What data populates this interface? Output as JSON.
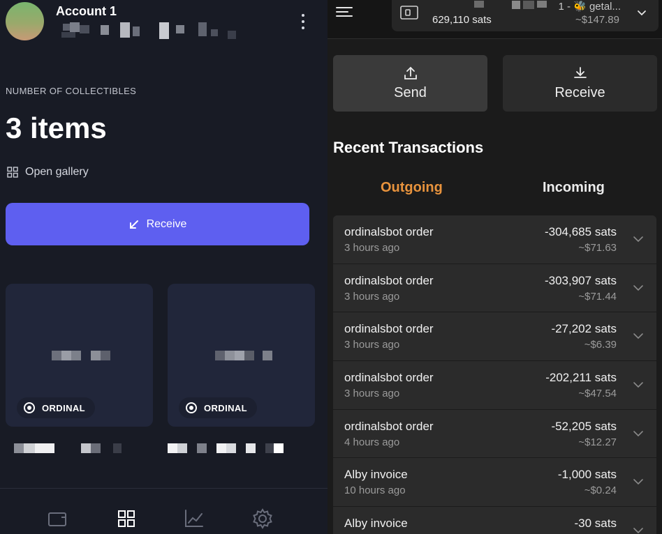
{
  "colors": {
    "left_bg": "#181b25",
    "accent": "#5e5ff0",
    "outgoing_tab": "#e8933d",
    "right_bg": "#1b1b1b",
    "card_bg": "#21263a"
  },
  "left": {
    "account_name": "Account 1",
    "collectibles_label": "NUMBER OF COLLECTIBLES",
    "collectibles_count": "3 items",
    "open_gallery_label": "Open gallery",
    "receive_label": "Receive",
    "cards": [
      {
        "badge_label": "ORDINAL"
      },
      {
        "badge_label": "ORDINAL"
      }
    ],
    "nav": [
      {
        "icon": "wallet-icon"
      },
      {
        "icon": "grid-icon"
      },
      {
        "icon": "chart-icon"
      },
      {
        "icon": "settings-icon"
      }
    ]
  },
  "right": {
    "account_selector": {
      "name_visible": "1 - 🐝 getal...",
      "balance_sats": "629,110 sats",
      "balance_usd": "~$147.89"
    },
    "actions": {
      "send_label": "Send",
      "receive_label": "Receive"
    },
    "recent_title": "Recent Transactions",
    "tabs": {
      "outgoing": "Outgoing",
      "incoming": "Incoming"
    },
    "transactions": [
      {
        "name": "ordinalsbot order",
        "time": "3 hours ago",
        "amount": "-304,685 sats",
        "usd": "~$71.63"
      },
      {
        "name": "ordinalsbot order",
        "time": "3 hours ago",
        "amount": "-303,907 sats",
        "usd": "~$71.44"
      },
      {
        "name": "ordinalsbot order",
        "time": "3 hours ago",
        "amount": "-27,202 sats",
        "usd": "~$6.39"
      },
      {
        "name": "ordinalsbot order",
        "time": "3 hours ago",
        "amount": "-202,211 sats",
        "usd": "~$47.54"
      },
      {
        "name": "ordinalsbot order",
        "time": "4 hours ago",
        "amount": "-52,205 sats",
        "usd": "~$12.27"
      },
      {
        "name": "Alby invoice",
        "time": "10 hours ago",
        "amount": "-1,000 sats",
        "usd": "~$0.24"
      },
      {
        "name": "Alby invoice",
        "time": "",
        "amount": "-30 sats",
        "usd": ""
      }
    ]
  }
}
